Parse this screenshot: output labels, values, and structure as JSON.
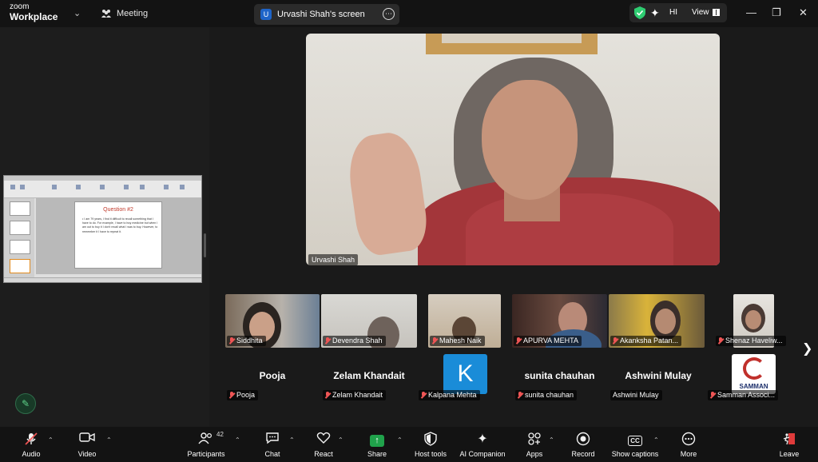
{
  "app": {
    "logo_line1": "zoom",
    "logo_line2": "Workplace"
  },
  "tabs": {
    "meeting_label": "Meeting",
    "screen_label": "Urvashi Shah's screen",
    "screen_badge": "U"
  },
  "top_right": {
    "hi_label": "HI",
    "view_label": "View"
  },
  "shared_slide": {
    "title": "Question #2",
    "body": "• I am 79 years, I find it difficult to recall something that I have to do. For example, I have to buy medicine but when I am out to buy it I don't recall what I was to buy. However, to remember it I have to repeat it."
  },
  "main_speaker": {
    "name": "Urvashi Shah"
  },
  "video_tiles": [
    {
      "name": "Siddhita"
    },
    {
      "name": "Devendra Shah"
    },
    {
      "name": "Mahesh Naik"
    },
    {
      "name": "APURVA MEHTA"
    },
    {
      "name": "Akanksha Patan..."
    },
    {
      "name": "Shenaz Haveliw..."
    }
  ],
  "name_tiles": [
    {
      "display": "Pooja",
      "label": "Pooja"
    },
    {
      "display": "Zelam Khandait",
      "label": "Zelam Khandait"
    },
    {
      "display": "K",
      "label": "Kalpana Mehta"
    },
    {
      "display": "sunita chauhan",
      "label": "sunita chauhan"
    },
    {
      "display": "Ashwini Mulay",
      "label": "Ashwini Mulay"
    },
    {
      "display": "SAMMAN",
      "label": "Samman Associ..."
    }
  ],
  "toolbar": {
    "audio": "Audio",
    "video": "Video",
    "participants": "Participants",
    "participants_count": "42",
    "chat": "Chat",
    "react": "React",
    "share": "Share",
    "host_tools": "Host tools",
    "ai_companion": "AI Companion",
    "apps": "Apps",
    "record": "Record",
    "show_captions": "Show captions",
    "captions_badge": "CC",
    "more": "More",
    "leave": "Leave"
  },
  "colors": {
    "accent_green": "#20a24b",
    "avatar_blue": "#1a8cd8",
    "mute_red": "#e55555"
  }
}
